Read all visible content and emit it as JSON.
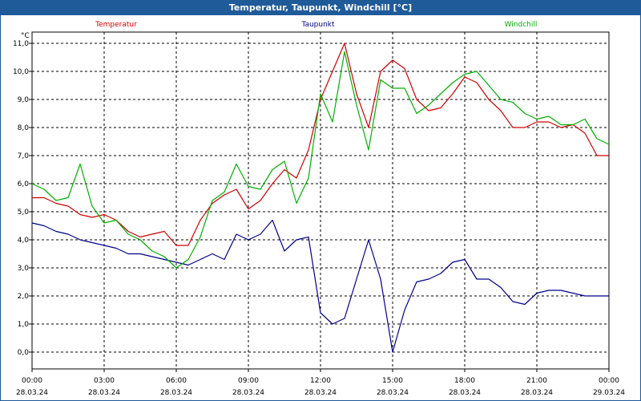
{
  "window": {
    "title": "Temperatur, Taupunkt, Windchill [°C]"
  },
  "chart_data": {
    "type": "line",
    "title": "Temperatur, Taupunkt, Windchill [°C]",
    "ylabel": "°C",
    "ylim": [
      -0.6,
      11.4
    ],
    "yticks": [
      "11,0",
      "10,0",
      "9,0",
      "8,0",
      "7,0",
      "6,0",
      "5,0",
      "4,0",
      "3,0",
      "2,0",
      "1,0",
      "0,0"
    ],
    "ytick_values": [
      11,
      10,
      9,
      8,
      7,
      6,
      5,
      4,
      3,
      2,
      1,
      0
    ],
    "xticks": [
      {
        "time": "00:00",
        "date": "28.03.24"
      },
      {
        "time": "03:00",
        "date": "28.03.24"
      },
      {
        "time": "06:00",
        "date": "28.03.24"
      },
      {
        "time": "09:00",
        "date": "28.03.24"
      },
      {
        "time": "12:00",
        "date": "28.03.24"
      },
      {
        "time": "15:00",
        "date": "28.03.24"
      },
      {
        "time": "18:00",
        "date": "28.03.24"
      },
      {
        "time": "21:00",
        "date": "28.03.24"
      },
      {
        "time": "00:00",
        "date": "29.03.24"
      }
    ],
    "x_hours": [
      0,
      0.5,
      1,
      1.5,
      2,
      2.5,
      3,
      3.5,
      4,
      4.5,
      5,
      5.5,
      6,
      6.5,
      7,
      7.5,
      8,
      8.5,
      9,
      9.5,
      10,
      10.5,
      11,
      11.5,
      12,
      12.5,
      13,
      13.5,
      14,
      14.5,
      15,
      15.5,
      16,
      16.5,
      17,
      17.5,
      18,
      18.5,
      19,
      19.5,
      20,
      20.5,
      21,
      21.5,
      22,
      22.5,
      23,
      23.5,
      24
    ],
    "grid": true,
    "series": [
      {
        "name": "Temperatur",
        "color": "#d00000",
        "values": [
          5.5,
          5.5,
          5.3,
          5.2,
          4.9,
          4.8,
          4.9,
          4.7,
          4.3,
          4.1,
          4.2,
          4.3,
          3.8,
          3.8,
          4.7,
          5.3,
          5.6,
          5.8,
          5.1,
          5.4,
          6.0,
          6.5,
          6.2,
          7.2,
          9.0,
          10.0,
          11.0,
          9.2,
          8.0,
          10.0,
          10.4,
          10.1,
          9.0,
          8.6,
          8.7,
          9.2,
          9.8,
          9.6,
          9.0,
          8.6,
          8.0,
          8.0,
          8.2,
          8.2,
          8.0,
          8.1,
          7.8,
          7.0,
          7.0
        ]
      },
      {
        "name": "Taupunkt",
        "color": "#00008b",
        "values": [
          4.6,
          4.5,
          4.3,
          4.2,
          4.0,
          3.9,
          3.8,
          3.7,
          3.5,
          3.5,
          3.4,
          3.3,
          3.2,
          3.1,
          3.3,
          3.5,
          3.3,
          4.2,
          4.0,
          4.2,
          4.7,
          3.6,
          4.0,
          4.1,
          1.4,
          1.0,
          1.2,
          2.6,
          4.0,
          2.6,
          0.0,
          1.5,
          2.5,
          2.6,
          2.8,
          3.2,
          3.3,
          2.6,
          2.6,
          2.3,
          1.8,
          1.7,
          2.1,
          2.2,
          2.2,
          2.1,
          2.0,
          2.0,
          2.0
        ]
      },
      {
        "name": "Windchill",
        "color": "#00b000",
        "values": [
          6.0,
          5.8,
          5.4,
          5.5,
          6.7,
          5.2,
          4.6,
          4.7,
          4.2,
          4.0,
          3.6,
          3.4,
          3.0,
          3.3,
          4.1,
          5.4,
          5.7,
          6.7,
          5.9,
          5.8,
          6.5,
          6.8,
          5.3,
          6.2,
          9.2,
          8.2,
          10.7,
          8.8,
          7.2,
          9.7,
          9.4,
          9.4,
          8.5,
          8.8,
          9.2,
          9.6,
          9.9,
          10.0,
          9.5,
          9.0,
          8.9,
          8.5,
          8.3,
          8.4,
          8.1,
          8.1,
          8.3,
          7.6,
          7.4
        ]
      }
    ]
  }
}
